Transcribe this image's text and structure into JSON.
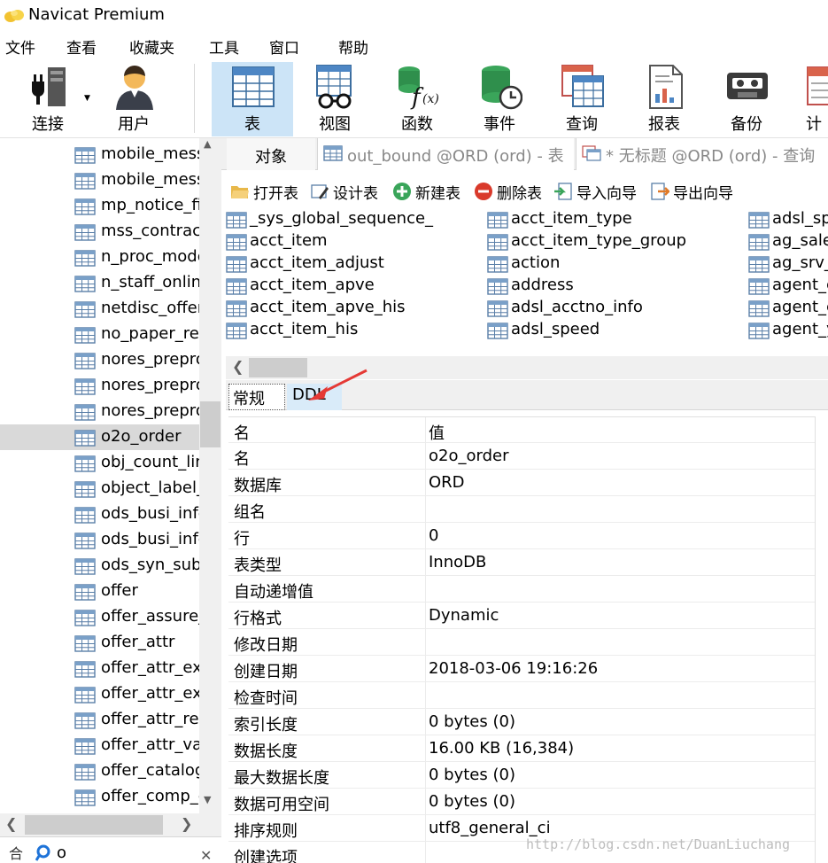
{
  "app": {
    "title": "Navicat Premium"
  },
  "menu": [
    "文件",
    "查看",
    "收藏夹",
    "工具",
    "窗口",
    "帮助"
  ],
  "toolbar": {
    "tools": [
      {
        "label": "连接",
        "icon": "plug-icon"
      },
      {
        "label": "用户",
        "icon": "user-icon"
      },
      {
        "label": "表",
        "icon": "table-icon"
      },
      {
        "label": "视图",
        "icon": "view-icon"
      },
      {
        "label": "函数",
        "icon": "function-icon"
      },
      {
        "label": "事件",
        "icon": "event-icon"
      },
      {
        "label": "查询",
        "icon": "query-icon"
      },
      {
        "label": "报表",
        "icon": "report-icon"
      },
      {
        "label": "备份",
        "icon": "backup-icon"
      },
      {
        "label": "计",
        "icon": "schedule-icon"
      }
    ],
    "active": "表"
  },
  "sidebar": {
    "items": [
      "mobile_mess",
      "mobile_mess",
      "mp_notice_fi",
      "mss_contract",
      "n_proc_mode",
      "n_staff_onlin",
      "netdisc_offer",
      "no_paper_rep",
      "nores_prepro",
      "nores_prepro",
      "nores_prepro",
      "o2o_order",
      "obj_count_lin",
      "object_label_",
      "ods_busi_info",
      "ods_busi_info",
      "ods_syn_subs",
      "offer",
      "offer_assure_",
      "offer_attr",
      "offer_attr_ext",
      "offer_attr_ext",
      "offer_attr_rer",
      "offer_attr_val",
      "offer_catalog",
      "offer_comp_e"
    ],
    "selected": "o2o_order",
    "search": {
      "clipped_label": "合",
      "value": "o"
    }
  },
  "tabs": {
    "objects": "对象",
    "out_bound": "out_bound @ORD (ord) - 表",
    "query": "* 无标题 @ORD (ord) - 查询"
  },
  "object_toolbar": {
    "open": "打开表",
    "design": "设计表",
    "new": "新建表",
    "delete": "删除表",
    "import": "导入向导",
    "export": "导出向导"
  },
  "object_list": {
    "col1": [
      "_sys_global_sequence_",
      "acct_item",
      "acct_item_adjust",
      "acct_item_apve",
      "acct_item_apve_his",
      "acct_item_his"
    ],
    "col2": [
      "acct_item_type",
      "acct_item_type_group",
      "action",
      "address",
      "adsl_acctno_info",
      "adsl_speed"
    ],
    "col3": [
      "adsl_sp",
      "ag_sale",
      "ag_srv_",
      "agent_c",
      "agent_c",
      "agent_y"
    ]
  },
  "info_tabs": {
    "general": "常规",
    "ddl": "DDL"
  },
  "properties": {
    "header": {
      "key": "名",
      "value": "值"
    },
    "rows": [
      {
        "key": "名",
        "value": "o2o_order"
      },
      {
        "key": "数据库",
        "value": "ORD"
      },
      {
        "key": "组名",
        "value": ""
      },
      {
        "key": "行",
        "value": "0"
      },
      {
        "key": "表类型",
        "value": "InnoDB"
      },
      {
        "key": "自动递增值",
        "value": ""
      },
      {
        "key": "行格式",
        "value": "Dynamic"
      },
      {
        "key": "修改日期",
        "value": ""
      },
      {
        "key": "创建日期",
        "value": "2018-03-06 19:16:26"
      },
      {
        "key": "检查时间",
        "value": ""
      },
      {
        "key": "索引长度",
        "value": "0 bytes (0)"
      },
      {
        "key": "数据长度",
        "value": "16.00 KB (16,384)"
      },
      {
        "key": "最大数据长度",
        "value": "0 bytes (0)"
      },
      {
        "key": "数据可用空间",
        "value": "0 bytes (0)"
      },
      {
        "key": "排序规则",
        "value": "utf8_general_ci"
      },
      {
        "key": "创建选项",
        "value": ""
      }
    ]
  },
  "watermark": "http://blog.csdn.net/DuanLiuchang",
  "colors": {
    "active_tool": "#cce4f7",
    "selected_row": "#d9d9d9",
    "ddl_tab": "#d9ebf9",
    "arrow": "#e53935"
  }
}
